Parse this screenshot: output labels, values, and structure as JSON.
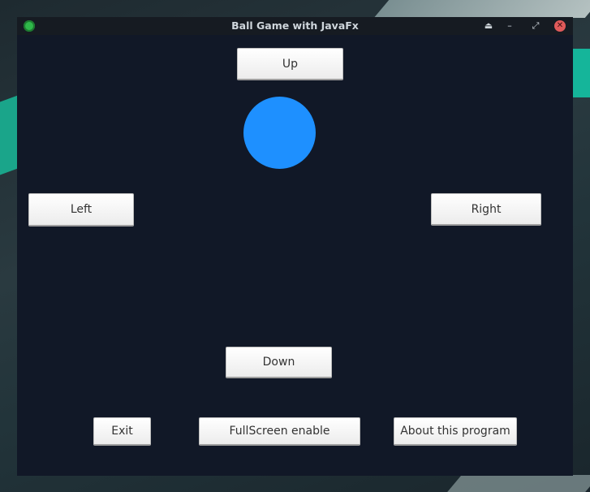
{
  "window": {
    "title": "Ball Game with JavaFx"
  },
  "titlebar_icons": [
    "eject-icon",
    "minimize-icon",
    "restore-icon",
    "close-icon"
  ],
  "controls": {
    "up": "Up",
    "left": "Left",
    "right": "Right",
    "down": "Down"
  },
  "footer": {
    "exit": "Exit",
    "fullscreen": "FullScreen enable",
    "about": "About this program"
  },
  "colors": {
    "background": "#111827",
    "ball": "#1e90ff"
  }
}
